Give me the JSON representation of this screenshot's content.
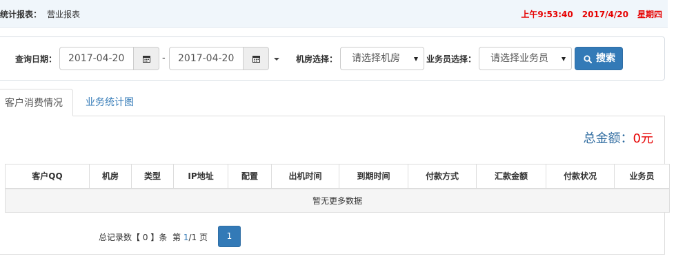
{
  "header": {
    "label": "统计报表：",
    "page": "营业报表",
    "time": "上午9:53:40",
    "date": "2017/4/20",
    "weekday": "星期四"
  },
  "filter": {
    "date_label": "查询日期：",
    "date_from": "2017-04-20",
    "date_sep": "-",
    "date_to": "2017-04-20",
    "room_label": "机房选择：",
    "room_value": "请选择机房",
    "staff_label": "业务员选择：",
    "staff_value": "请选择业务员",
    "search_label": "搜索"
  },
  "tabs": [
    {
      "label": "客户消费情况",
      "active": true
    },
    {
      "label": "业务统计图",
      "active": false
    }
  ],
  "summary": {
    "total_label": "总金额：",
    "total_value": "0元"
  },
  "table": {
    "columns": [
      "客户QQ",
      "机房",
      "类型",
      "IP地址",
      "配置",
      "出机时间",
      "到期时间",
      "付款方式",
      "汇款金额",
      "付款状况",
      "业务员"
    ],
    "empty_text": "暂无更多数据"
  },
  "pagination": {
    "records_prefix": "总记录数【",
    "records_count": "0",
    "records_suffix": "】条",
    "page_prefix": "第",
    "current_page": "1",
    "page_sep": "/1 页",
    "page_button": "1"
  },
  "colors": {
    "primary": "#337ab7",
    "alert": "#e60000",
    "topbar_bg": "#f0f6fb"
  },
  "icons": {
    "calendar": "calendar-icon",
    "search": "search-icon"
  }
}
